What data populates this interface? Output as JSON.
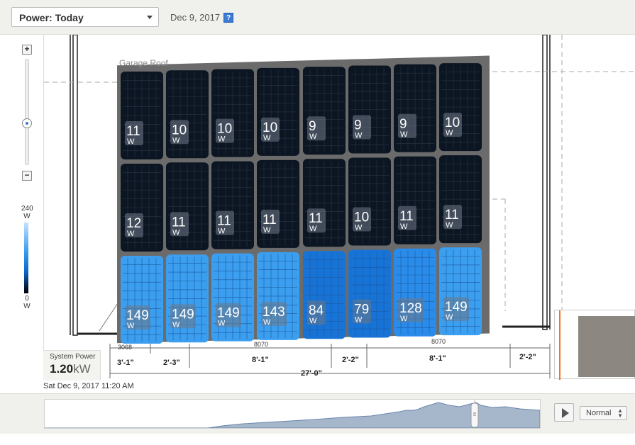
{
  "header": {
    "view_select": "Power: Today",
    "date": "Dec 9, 2017",
    "help_icon": "help-icon"
  },
  "zoom": {
    "plus_label": "+",
    "minus_label": "−",
    "level": 0.6
  },
  "legend": {
    "max": "240",
    "min": "0",
    "unit": "W"
  },
  "roof": {
    "label": "Garage Roof"
  },
  "panels": {
    "unit": "W",
    "rows": [
      [
        11,
        10,
        10,
        10,
        9,
        9,
        9,
        10
      ],
      [
        12,
        11,
        11,
        11,
        11,
        10,
        11,
        11
      ],
      [
        149,
        149,
        149,
        143,
        84,
        79,
        128,
        149
      ]
    ]
  },
  "dimensions": {
    "labels": [
      "3'-1\"",
      "2'-3\"",
      "8'-1\"",
      "2'-2\"",
      "8'-1\"",
      "2'-2\"",
      "27'-0\""
    ],
    "window_codes": [
      "3068",
      "8070",
      "8070"
    ]
  },
  "system_power": {
    "title": "System Power",
    "value": "1.20",
    "unit": "kW"
  },
  "timestamp": "Sat Dec 9, 2017 11:20 AM",
  "playback": {
    "play_icon": "play-icon",
    "speed": "Normal"
  },
  "colors": {
    "accent": "#3a7bd5",
    "panel_dark": "#0c1522",
    "panel_bright": "#3b9eef",
    "panel_mid": "#1a79dc",
    "minimap_frame": "#e9772c"
  }
}
